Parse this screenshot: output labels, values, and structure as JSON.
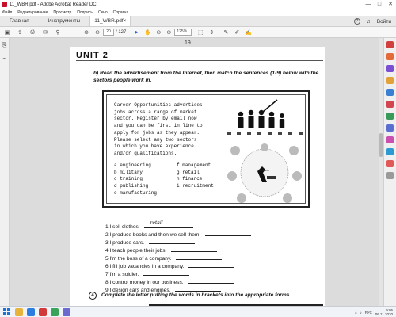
{
  "window": {
    "title": "11_WBR.pdf - Adobe Acrobat Reader DC",
    "controls": [
      "—",
      "□",
      "✕"
    ]
  },
  "menubar": {
    "items": [
      "Файл",
      "Редактирование",
      "Просмотр",
      "Подпись",
      "Окно",
      "Справка"
    ]
  },
  "tabs": {
    "home": "Главная",
    "tools": "Инструменты",
    "document": "11_WBR.pdf",
    "login": "Войти"
  },
  "toolbar": {
    "current_page": "20",
    "total_pages": "/ 127",
    "zoom": "125%"
  },
  "document": {
    "page_number": "19",
    "unit_title": "UNIT 2",
    "instruction": "b) Read the advertisement from the Internet, then match the sentences (1-9) below with the sectors people work in.",
    "ad_text": "Career Opportunities advertises\njobs across a range of market\nsector. Register by email now\nand you can be first in line to\napply for jobs as they appear.\nPlease select any two sectors\nin which you have experience\nand/or qualifications.",
    "sectors": [
      "a engineering",
      "b military",
      "c training",
      "d publishing",
      "e manufacturing",
      "f management",
      "g retail",
      "h finance",
      "i recruitment"
    ],
    "diagram_labels": [
      "Job Search"
    ],
    "sentences": [
      "1 I sell clothes.",
      "2 I produce books and then we sell them.",
      "3 I produce cars.",
      "4 I teach people their jobs.",
      "5 I'm the boss of a company.",
      "6 I fill job vacancies in a company.",
      "7 I'm a soldier.",
      "8 I control money in our business.",
      "9 I design cars and engines."
    ],
    "sentence1_answer": "retail",
    "exercise4_number": "4",
    "exercise4_text": "Complete the letter putting the words in brackets into the appropriate forms."
  },
  "taskbar": {
    "lang": "РУС",
    "time": "9:05",
    "date": "06.11.2020"
  },
  "colors": {
    "acrobat_red": "#c8102e",
    "win_blue": "#1a73d9"
  }
}
